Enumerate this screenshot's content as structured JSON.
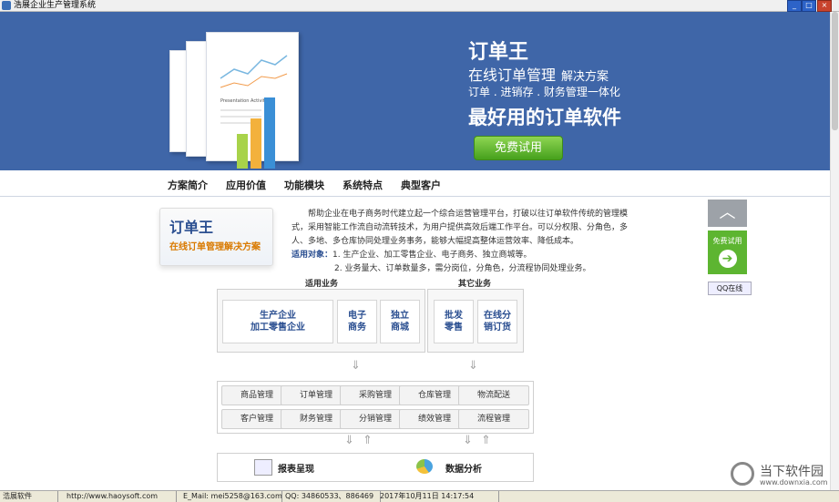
{
  "window": {
    "title": "浩展企业生产管理系统"
  },
  "banner": {
    "logo": "订单王",
    "subtitle": "在线订单管理",
    "subtitle_suffix": "解决方案",
    "tagline": "订单 . 进销存 . 财务管理一体化",
    "slogan": "最好用的订单软件",
    "try_button": "免费试用",
    "illustration_text": "Presentation Activity"
  },
  "nav": {
    "tabs": [
      "方案简介",
      "应用价值",
      "功能模块",
      "系统特点",
      "典型客户"
    ]
  },
  "intro_card": {
    "title": "订单王",
    "subtitle": "在线订单管理解决方案"
  },
  "intro": {
    "paragraph": "帮助企业在电子商务时代建立起一个综合运营管理平台，打破以往订单软件传统的管理模式，采用智能工作流自动流转技术，为用户提供高效后端工作平台。可以分权限、分角色，多人、多地、多仓库协同处理业务事务，能够大幅提高整体运营效率、降低成本。",
    "target_label": "适用对象：",
    "target_1": "1. 生产企业、加工零售企业、电子商务、独立商城等。",
    "target_2": "2. 业务量大、订单数量多，需分岗位，分角色，分流程协同处理业务。"
  },
  "diagram": {
    "applicable_label": "适用业务",
    "other_label": "其它业务",
    "applicable": [
      "生产企业\n加工零售企业",
      "电子\n商务",
      "独立\n商城"
    ],
    "other": [
      "批发\n零售",
      "在线分\n销订货"
    ],
    "modules_row1": [
      "商品管理",
      "订单管理",
      "采购管理",
      "仓库管理",
      "物流配送"
    ],
    "modules_row2": [
      "客户管理",
      "财务管理",
      "分销管理",
      "绩效管理",
      "流程管理"
    ],
    "report": "报表呈现",
    "analysis": "数据分析"
  },
  "sidebar": {
    "up": "︿",
    "try": "免费试用",
    "try_arrow": "➔",
    "qq": "QQ在线"
  },
  "watermark": {
    "name": "当下软件园",
    "url": "www.downxia.com"
  },
  "statusbar": {
    "company": "浩展软件",
    "website": "http://www.haoysoft.com",
    "email": "E_Mail: mei5258@163.com",
    "qq": "QQ: 34860533、886469",
    "datetime": "2017年10月11日  14:17:54"
  }
}
